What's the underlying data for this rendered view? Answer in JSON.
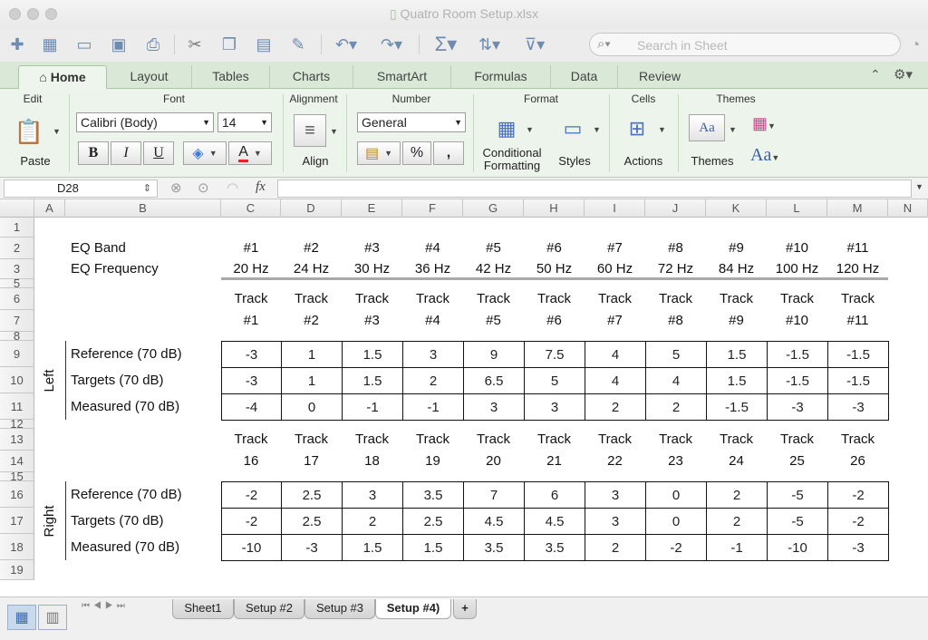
{
  "window": {
    "title": "Quatro Room Setup.xlsx"
  },
  "search": {
    "placeholder": "Search in Sheet"
  },
  "ribbon_tabs": [
    "Home",
    "Layout",
    "Tables",
    "Charts",
    "SmartArt",
    "Formulas",
    "Data",
    "Review"
  ],
  "ribbon": {
    "groups": {
      "edit": "Edit",
      "font": "Font",
      "alignment": "Alignment",
      "number": "Number",
      "format": "Format",
      "cells": "Cells",
      "themes": "Themes"
    },
    "paste_label": "Paste",
    "font_name": "Calibri (Body)",
    "font_size": "14",
    "bold": "B",
    "italic": "I",
    "underline": "U",
    "font_color_glyph": "A",
    "align_label": "Align",
    "number_format": "General",
    "percent": "%",
    "comma": ",",
    "conditional_formatting_1": "Conditional",
    "conditional_formatting_2": "Formatting",
    "styles_label": "Styles",
    "actions_label": "Actions",
    "themes_label": "Themes",
    "aa_glyph": "Aa",
    "font_color_accent": "#e32626"
  },
  "formula_bar": {
    "cell_ref": "D28",
    "fx": "fx",
    "content": ""
  },
  "columns": [
    "A",
    "B",
    "C",
    "D",
    "E",
    "F",
    "G",
    "H",
    "I",
    "J",
    "K",
    "L",
    "M",
    "N"
  ],
  "rows": [
    "1",
    "2",
    "3",
    "5",
    "6",
    "7",
    "8",
    "9",
    "10",
    "11",
    "12",
    "13",
    "14",
    "15",
    "16",
    "17",
    "18",
    "19"
  ],
  "sheet": {
    "eq_band_label": "EQ Band",
    "eq_freq_label": "EQ Frequency",
    "bands": [
      "#1",
      "#2",
      "#3",
      "#4",
      "#5",
      "#6",
      "#7",
      "#8",
      "#9",
      "#10",
      "#11"
    ],
    "frequencies": [
      "20 Hz",
      "24 Hz",
      "30 Hz",
      "36 Hz",
      "42 Hz",
      "50 Hz",
      "60 Hz",
      "72 Hz",
      "84 Hz",
      "100 Hz",
      "120 Hz"
    ],
    "track_word": "Track",
    "left": {
      "label": "Left",
      "tracks": [
        "#1",
        "#2",
        "#3",
        "#4",
        "#5",
        "#6",
        "#7",
        "#8",
        "#9",
        "#10",
        "#11"
      ],
      "rows": [
        {
          "label": "Reference (70 dB)",
          "values": [
            "-3",
            "1",
            "1.5",
            "3",
            "9",
            "7.5",
            "4",
            "5",
            "1.5",
            "-1.5",
            "-1.5"
          ]
        },
        {
          "label": "Targets (70 dB)",
          "values": [
            "-3",
            "1",
            "1.5",
            "2",
            "6.5",
            "5",
            "4",
            "4",
            "1.5",
            "-1.5",
            "-1.5"
          ]
        },
        {
          "label": "Measured (70 dB)",
          "values": [
            "-4",
            "0",
            "-1",
            "-1",
            "3",
            "3",
            "2",
            "2",
            "-1.5",
            "-3",
            "-3"
          ]
        }
      ]
    },
    "right": {
      "label": "Right",
      "tracks": [
        "16",
        "17",
        "18",
        "19",
        "20",
        "21",
        "22",
        "23",
        "24",
        "25",
        "26"
      ],
      "rows": [
        {
          "label": "Reference (70 dB)",
          "values": [
            "-2",
            "2.5",
            "3",
            "3.5",
            "7",
            "6",
            "3",
            "0",
            "2",
            "-5",
            "-2"
          ]
        },
        {
          "label": "Targets (70 dB)",
          "values": [
            "-2",
            "2.5",
            "2",
            "2.5",
            "4.5",
            "4.5",
            "3",
            "0",
            "2",
            "-5",
            "-2"
          ]
        },
        {
          "label": "Measured (70 dB)",
          "values": [
            "-10",
            "-3",
            "1.5",
            "1.5",
            "3.5",
            "3.5",
            "2",
            "-2",
            "-1",
            "-10",
            "-3"
          ]
        }
      ]
    }
  },
  "sheet_tabs": [
    "Sheet1",
    "Setup #2",
    "Setup #3",
    "Setup #4)"
  ],
  "add_sheet": "+"
}
